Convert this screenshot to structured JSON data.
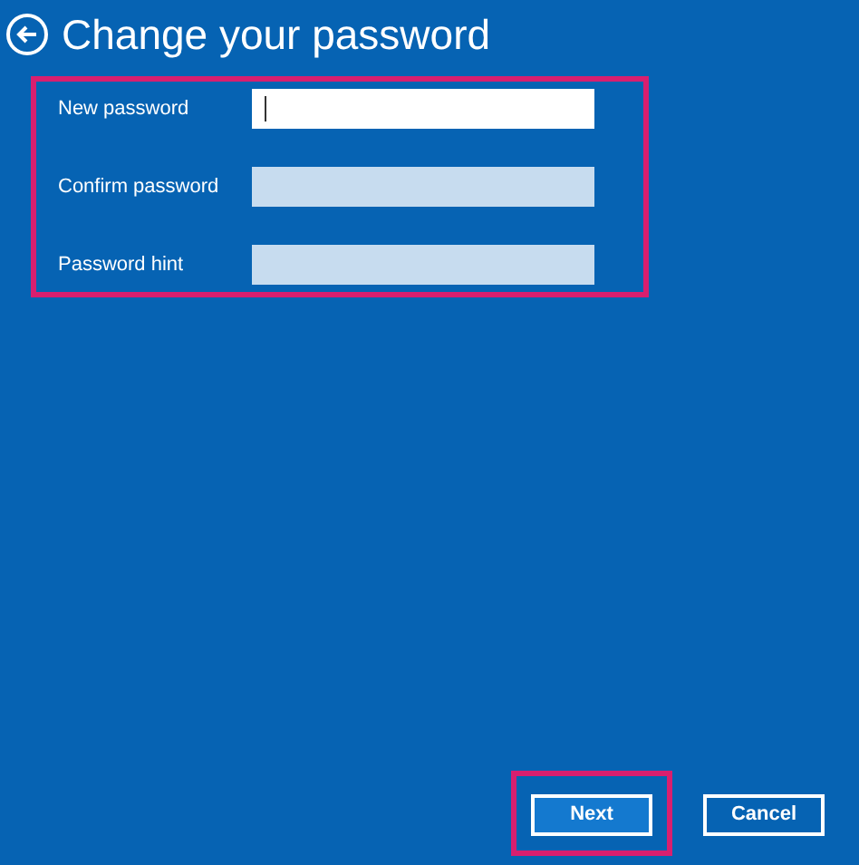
{
  "title": "Change your password",
  "form": {
    "highlighted": true,
    "fields": [
      {
        "label": "New password",
        "focused": true
      },
      {
        "label": "Confirm password",
        "focused": false
      },
      {
        "label": "Password hint",
        "focused": false
      }
    ]
  },
  "buttons": [
    {
      "label": "Next",
      "highlighted": true
    },
    {
      "label": "Cancel",
      "highlighted": false
    }
  ]
}
